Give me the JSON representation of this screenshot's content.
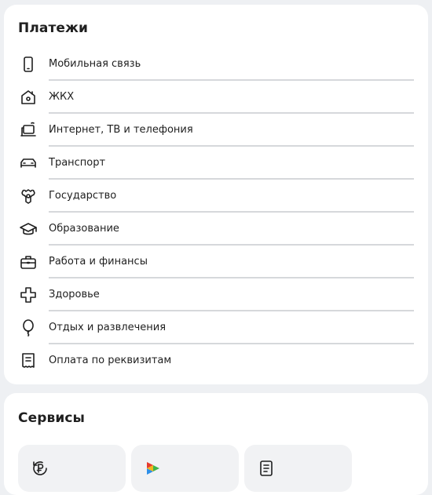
{
  "payments": {
    "title": "Платежи",
    "items": [
      {
        "label": "Мобильная связь",
        "icon": "phone-icon"
      },
      {
        "label": "ЖКХ",
        "icon": "house-icon"
      },
      {
        "label": "Интернет, ТВ и телефония",
        "icon": "laptop-icon"
      },
      {
        "label": "Транспорт",
        "icon": "car-icon"
      },
      {
        "label": "Государство",
        "icon": "coat-of-arms-icon"
      },
      {
        "label": "Образование",
        "icon": "graduation-cap-icon"
      },
      {
        "label": "Работа и финансы",
        "icon": "briefcase-icon"
      },
      {
        "label": "Здоровье",
        "icon": "medical-cross-icon"
      },
      {
        "label": "Отдых и развлечения",
        "icon": "balloon-icon"
      },
      {
        "label": "Оплата по реквизитам",
        "icon": "document-icon"
      }
    ]
  },
  "services": {
    "title": "Сервисы",
    "tiles": [
      {
        "icon": "ruble-refresh-icon"
      },
      {
        "icon": "color-arrows-icon"
      },
      {
        "icon": "receipt-icon"
      }
    ]
  },
  "colors": {
    "background": "#eef0f3",
    "card": "#ffffff",
    "tile": "#f1f2f4",
    "divider": "#d6d8db",
    "text": "#1f1f1f"
  }
}
